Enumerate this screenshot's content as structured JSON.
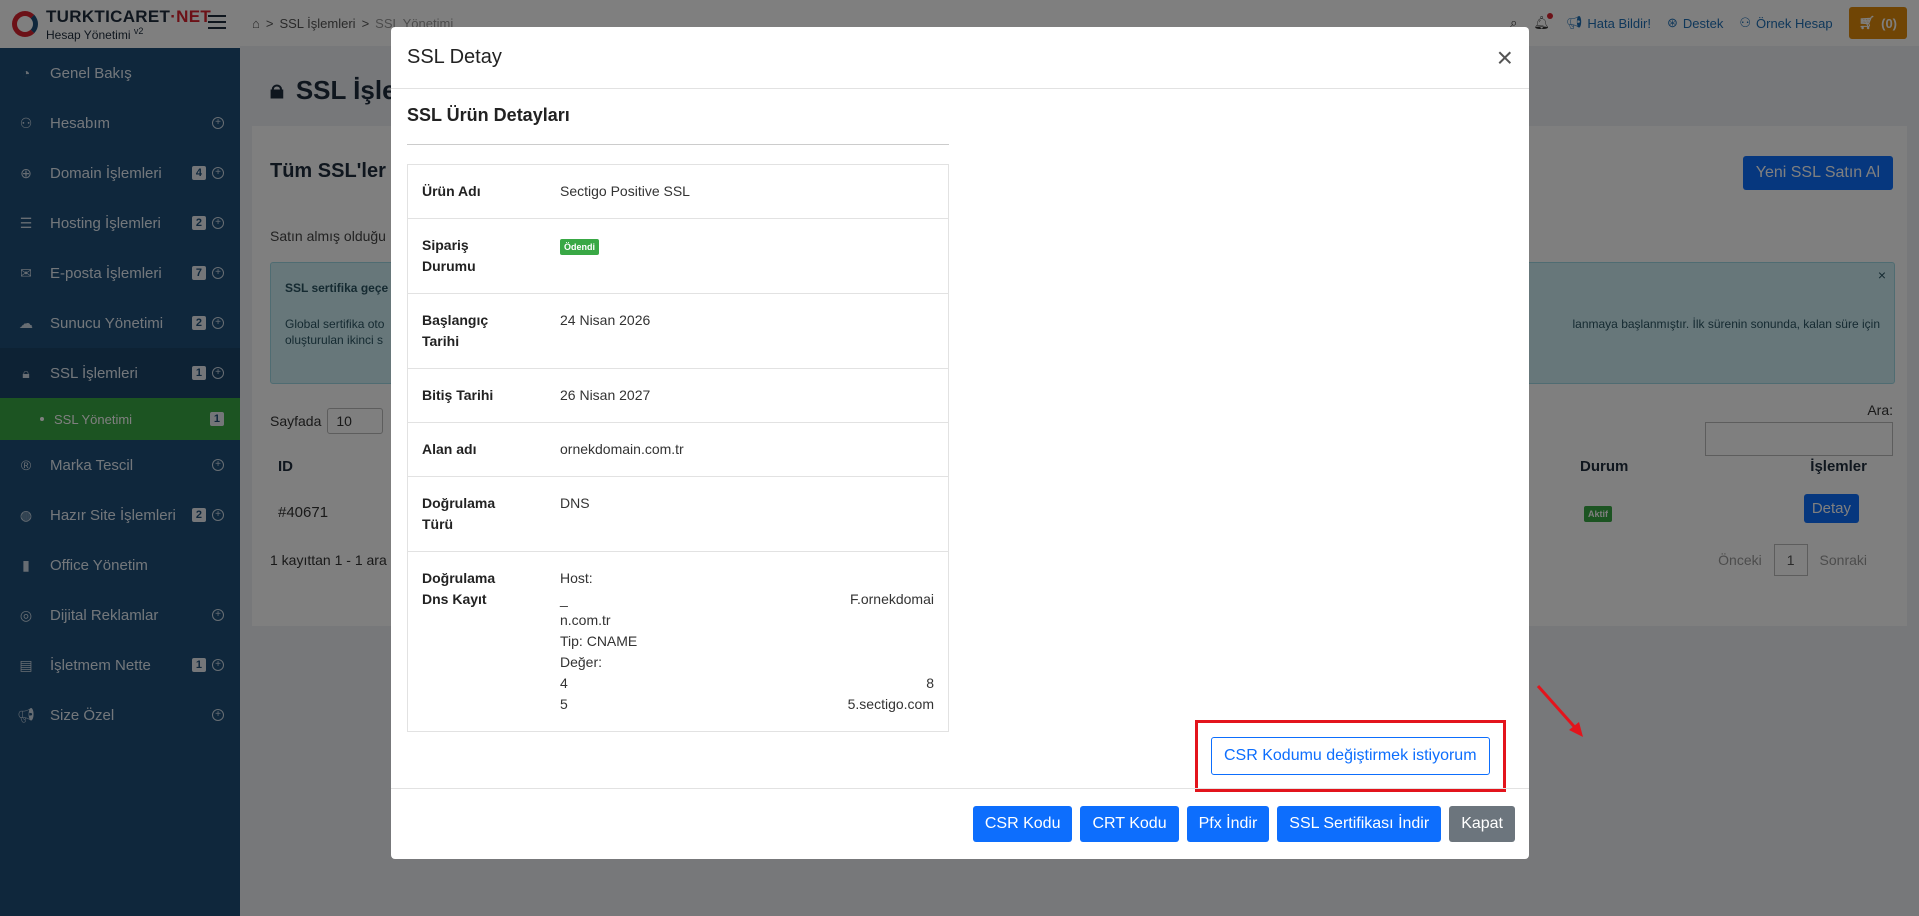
{
  "brand": {
    "name_main": "TURKTICARET",
    "name_accent": "·NET",
    "subtitle": "Hesap Yönetimi",
    "version": "v2"
  },
  "sidebar": {
    "items": [
      {
        "label": "Genel Bakış",
        "badge": "",
        "plus": false
      },
      {
        "label": "Hesabım",
        "badge": "",
        "plus": true
      },
      {
        "label": "Domain İşlemleri",
        "badge": "4",
        "plus": true
      },
      {
        "label": "Hosting İşlemleri",
        "badge": "2",
        "plus": true
      },
      {
        "label": "E-posta İşlemleri",
        "badge": "7",
        "plus": true
      },
      {
        "label": "Sunucu Yönetimi",
        "badge": "2",
        "plus": true
      },
      {
        "label": "SSL İşlemleri",
        "badge": "1",
        "plus": true
      },
      {
        "label": "Marka Tescil",
        "badge": "",
        "plus": true
      },
      {
        "label": "Hazır Site İşlemleri",
        "badge": "2",
        "plus": true
      },
      {
        "label": "Office Yönetim",
        "badge": "",
        "plus": false
      },
      {
        "label": "Dijital Reklamlar",
        "badge": "",
        "plus": true
      },
      {
        "label": "İşletmem Nette",
        "badge": "1",
        "plus": true
      },
      {
        "label": "Size Özel",
        "badge": "",
        "plus": true
      }
    ],
    "submenu": {
      "label": "SSL Yönetimi",
      "badge": "1"
    }
  },
  "topbar": {
    "breadcrumb": {
      "first": "SSL İşlemleri",
      "second": "SSL Yönetimi"
    },
    "hata": "Hata Bildir!",
    "destek": "Destek",
    "account": "Örnek Hesap",
    "cart": "(0)"
  },
  "page": {
    "title": "SSL İşle",
    "card_title": "Tüm SSL'ler",
    "new_button": "Yeni SSL Satın Al",
    "desc": "Satın almış olduğu",
    "info": {
      "title": "SSL sertifika geçe",
      "line1": "Global sertifika oto",
      "line2": "oluşturulan ikinci s",
      "line1_right": "lanmaya başlanmıştır. İlk sürenin sonunda, kalan süre için",
      "close": "×"
    },
    "per_page_label": "Sayfada",
    "per_page_value": "10",
    "search_label": "Ara:",
    "columns": {
      "id": "ID",
      "durum": "Durum",
      "islemler": "İşlemler"
    },
    "row": {
      "id": "#40671",
      "status": "Aktif",
      "detail": "Detay"
    },
    "record_info": "1 kayıttan 1 - 1 ara",
    "pager": {
      "prev": "Önceki",
      "page": "1",
      "next": "Sonraki"
    }
  },
  "modal": {
    "title": "SSL Detay",
    "section_title": "SSL Ürün Detayları",
    "rows": {
      "urun_adi": {
        "key": "Ürün Adı",
        "value": "Sectigo Positive SSL"
      },
      "siparis": {
        "key": "Sipariş Durumu",
        "value": "Ödendi"
      },
      "baslangic": {
        "key": "Başlangıç Tarihi",
        "value": "24 Nisan 2026"
      },
      "bitis": {
        "key": "Bitiş Tarihi",
        "value": "26 Nisan 2027"
      },
      "alan": {
        "key": "Alan adı",
        "value": "ornekdomain.com.tr"
      },
      "dogrulama": {
        "key": "Doğrulama Türü",
        "value": "DNS"
      },
      "dns": {
        "key": "Doğrulama Dns Kayıt",
        "host_label": "Host:",
        "host_left": "_",
        "host_right": "F.ornekdomai",
        "host_cont": "n.com.tr",
        "tip": "Tip: CNAME",
        "deger_label": "Değer:",
        "v1_left": "4",
        "v1_right": "8",
        "v2_left": "5",
        "v2_right": "5.sectigo.com"
      }
    },
    "csr_change": "CSR Kodumu değiştirmek istiyorum",
    "buttons": {
      "csr": "CSR Kodu",
      "crt": "CRT Kodu",
      "pfx": "Pfx İndir",
      "ssl": "SSL Sertifikası İndir",
      "close": "Kapat"
    },
    "close_icon": "×"
  },
  "colors": {
    "sidebar": "#1f4f79",
    "accent": "#0d6efd",
    "success": "#39a845",
    "highlight": "#e3141c",
    "cart": "#e08a0b"
  }
}
